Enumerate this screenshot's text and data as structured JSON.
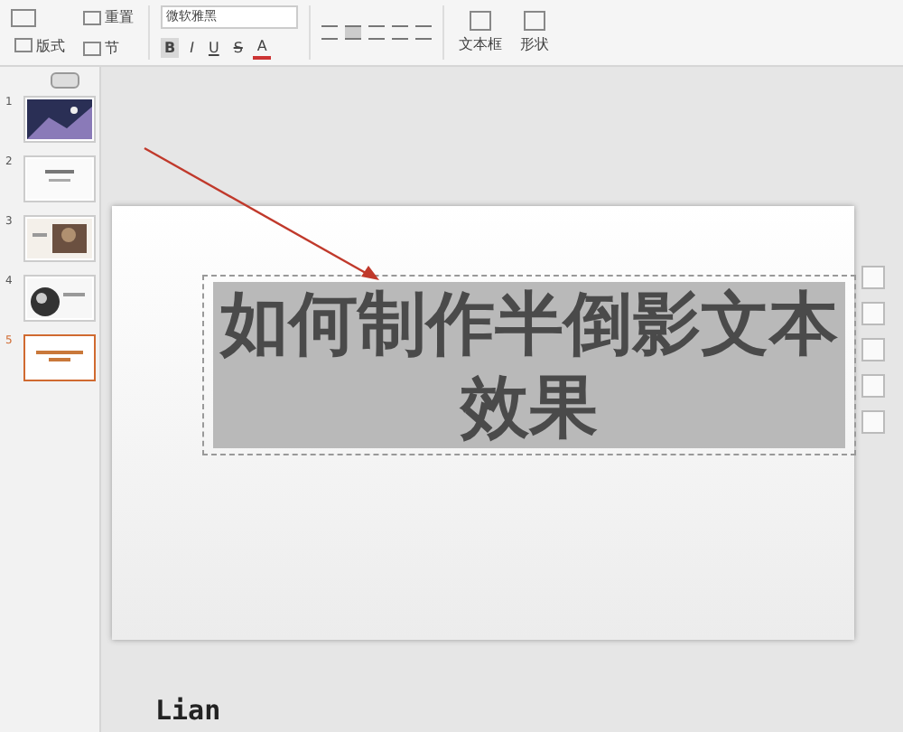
{
  "toolbar": {
    "layout_button": "版式",
    "slide_buttons": [
      {
        "label": "重置"
      },
      {
        "label": "节"
      }
    ],
    "font_field": "微软雅黑",
    "format_buttons": [
      "B",
      "I",
      "U",
      "S",
      "A"
    ],
    "insert_buttons": [
      "文本框",
      "形状"
    ]
  },
  "thumbnails": [
    {
      "number": "1",
      "kind": "night",
      "selected": false
    },
    {
      "number": "2",
      "kind": "text",
      "selected": false
    },
    {
      "number": "3",
      "kind": "photo",
      "selected": false
    },
    {
      "number": "4",
      "kind": "globe",
      "selected": false
    },
    {
      "number": "5",
      "kind": "title",
      "selected": true
    }
  ],
  "slide": {
    "title": "如何制作半倒影文本效果",
    "selected": true
  },
  "signature": "Lian"
}
